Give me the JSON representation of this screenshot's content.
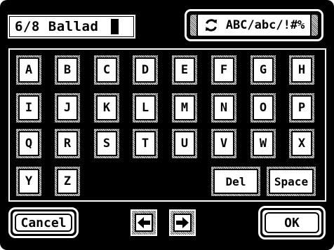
{
  "name_display": {
    "value": "6/8 Ballad"
  },
  "mode_button": {
    "label": "ABC/abc/!#%",
    "icon": "refresh-icon"
  },
  "keys": [
    [
      "A",
      "B",
      "C",
      "D",
      "E",
      "F",
      "G",
      "H"
    ],
    [
      "I",
      "J",
      "K",
      "L",
      "M",
      "N",
      "O",
      "P"
    ],
    [
      "Q",
      "R",
      "S",
      "T",
      "U",
      "V",
      "W",
      "X"
    ],
    [
      "Y",
      "Z"
    ]
  ],
  "special_keys": {
    "delete": "Del",
    "space": "Space"
  },
  "footer": {
    "cancel": "Cancel",
    "ok": "OK",
    "left_icon": "arrow-left-icon",
    "right_icon": "arrow-right-icon"
  },
  "colors": {
    "screen": "#000000",
    "key_face": "#ffffff",
    "hatch_light": "#f2f2f2",
    "hatch_dark": "#4a4a4a"
  }
}
